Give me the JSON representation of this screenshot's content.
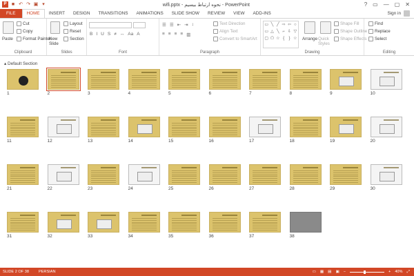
{
  "window": {
    "title": "wifi.pptx - نحوه ارتباط بیسیم - PowerPoint",
    "controls": [
      "?",
      "▭",
      "—",
      "▢",
      "✕"
    ]
  },
  "tabs": [
    "FILE",
    "HOME",
    "INSERT",
    "DESIGN",
    "TRANSITIONS",
    "ANIMATIONS",
    "SLIDE SHOW",
    "REVIEW",
    "VIEW",
    "ADD-INS"
  ],
  "active_tab": "HOME",
  "account": {
    "signin": "Sign in"
  },
  "ribbon": {
    "clipboard": {
      "label": "Clipboard",
      "paste": "Paste",
      "cut": "Cut",
      "copy": "Copy",
      "format_painter": "Format Painter"
    },
    "slides": {
      "label": "Slides",
      "new_slide": "New Slide",
      "layout": "Layout",
      "reset": "Reset",
      "section": "Section"
    },
    "font": {
      "label": "Font"
    },
    "paragraph": {
      "label": "Paragraph",
      "text_direction": "Text Direction",
      "align_text": "Align Text",
      "convert": "Convert to SmartArt"
    },
    "drawing": {
      "label": "Drawing",
      "arrange": "Arrange",
      "quick_styles": "Quick Styles",
      "shape_fill": "Shape Fill",
      "shape_outline": "Shape Outline",
      "shape_effects": "Shape Effects"
    },
    "editing": {
      "label": "Editing",
      "find": "Find",
      "replace": "Replace",
      "select": "Select"
    }
  },
  "sorter": {
    "section_name": "Default Section",
    "selected_slide": 2,
    "slides": [
      "1",
      "2",
      "3",
      "4",
      "5",
      "6",
      "7",
      "8",
      "9",
      "10",
      "11",
      "12",
      "13",
      "14",
      "15",
      "16",
      "17",
      "18",
      "19",
      "20",
      "21",
      "22",
      "23",
      "24",
      "25",
      "26",
      "27",
      "28",
      "29",
      "30",
      "31",
      "32",
      "33",
      "34",
      "35",
      "36",
      "37",
      "38"
    ],
    "slide_count": 38
  },
  "statusbar": {
    "slide_info": "SLIDE 2 OF 38",
    "language": "PERSIAN",
    "zoom": "40%"
  }
}
